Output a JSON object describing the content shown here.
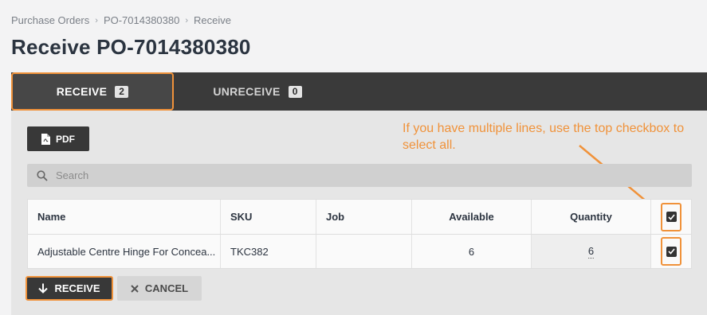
{
  "breadcrumb": {
    "item1": "Purchase Orders",
    "item2": "PO-7014380380",
    "item3": "Receive"
  },
  "page_title": "Receive PO-7014380380",
  "tabs": [
    {
      "label": "RECEIVE",
      "count": "2",
      "active": true
    },
    {
      "label": "UNRECEIVE",
      "count": "0",
      "active": false
    }
  ],
  "toolbar": {
    "pdf_label": "PDF"
  },
  "annotation": "If you have multiple lines, use the top checkbox to select all.",
  "search": {
    "placeholder": "Search",
    "value": ""
  },
  "table": {
    "headers": {
      "name": "Name",
      "sku": "SKU",
      "job": "Job",
      "available": "Available",
      "quantity": "Quantity"
    },
    "rows": [
      {
        "name": "Adjustable Centre Hinge For Concea...",
        "sku": "TKC382",
        "job": "",
        "available": "6",
        "quantity": "6",
        "checked": true
      }
    ],
    "select_all_checked": true
  },
  "actions": {
    "receive_label": "RECEIVE",
    "cancel_label": "CANCEL"
  },
  "colors": {
    "accent": "#f0923a",
    "tabbar": "#3a3a3a",
    "button_dark": "#383838"
  },
  "icons": [
    "chevron-right-icon",
    "pdf-file-icon",
    "search-icon",
    "checkmark-icon",
    "arrow-down-icon",
    "close-icon"
  ]
}
